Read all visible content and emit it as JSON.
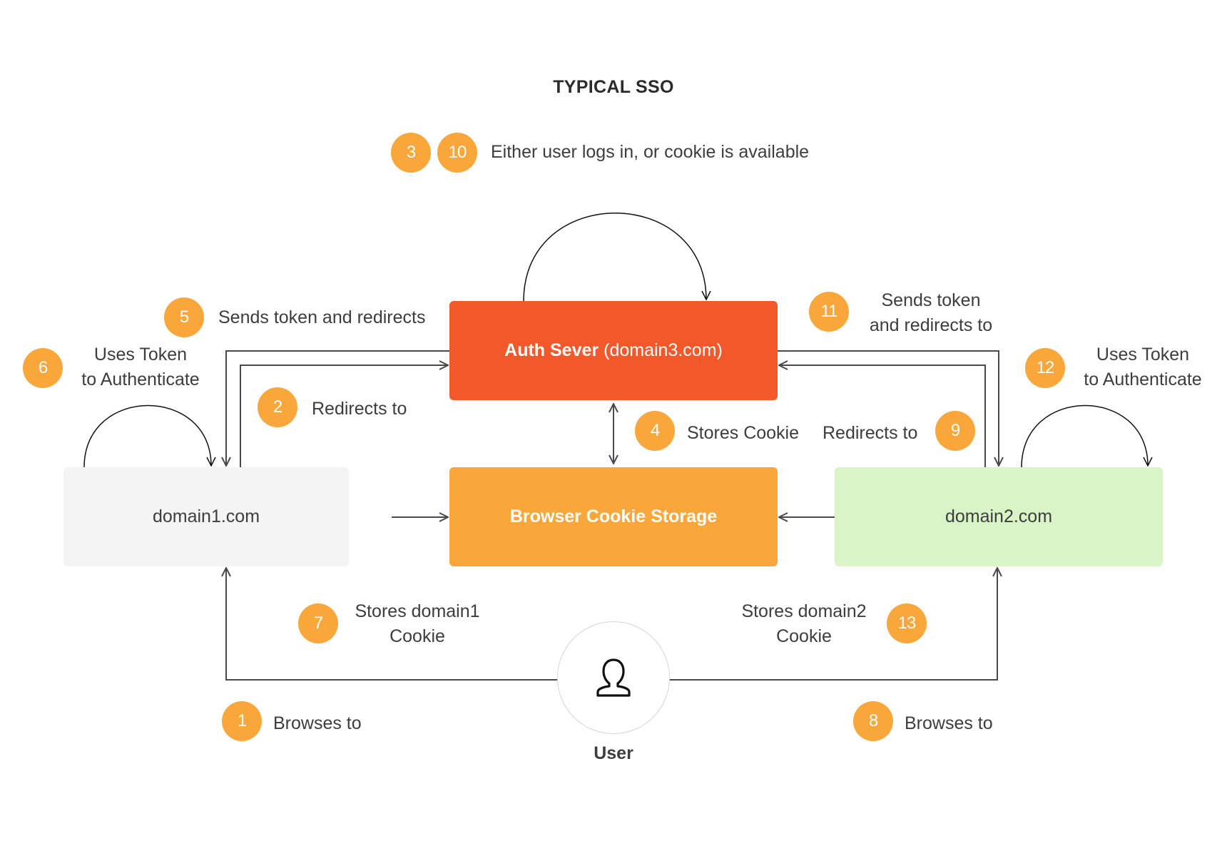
{
  "title": "TYPICAL SSO",
  "nodes": {
    "auth_server": {
      "name": "Auth Sever",
      "domain": "(domain3.com)",
      "color": "#F2582A"
    },
    "cookie_storage": {
      "label": "Browser Cookie Storage",
      "color": "#F9A73A"
    },
    "domain1": {
      "label": "domain1.com",
      "color": "#F4F4F4"
    },
    "domain2": {
      "label": "domain2.com",
      "color": "#D9F4C7"
    },
    "user": {
      "label": "User",
      "icon": "user-icon"
    }
  },
  "steps": {
    "s1": {
      "num": "1",
      "text": "Browses to"
    },
    "s2": {
      "num": "2",
      "text": "Redirects to"
    },
    "s3": {
      "num": "3"
    },
    "s10": {
      "num": "10",
      "text": "Either user logs in, or cookie is available"
    },
    "s4": {
      "num": "4",
      "text": "Stores Cookie"
    },
    "s5": {
      "num": "5",
      "text": "Sends token and redirects"
    },
    "s6": {
      "num": "6",
      "line1": "Uses Token",
      "line2": "to Authenticate"
    },
    "s7": {
      "num": "7",
      "line1": "Stores domain1",
      "line2": "Cookie"
    },
    "s8": {
      "num": "8",
      "text": "Browses to"
    },
    "s9": {
      "num": "9",
      "text": "Redirects to"
    },
    "s11": {
      "num": "11",
      "line1": "Sends token",
      "line2": "and redirects to"
    },
    "s12": {
      "num": "12",
      "line1": "Uses Token",
      "line2": "to Authenticate"
    },
    "s13": {
      "num": "13",
      "line1": "Stores domain2",
      "line2": "Cookie"
    }
  },
  "colors": {
    "badge": "#F9A73A",
    "line": "#4a4a4a",
    "text": "#3d3d3d"
  }
}
